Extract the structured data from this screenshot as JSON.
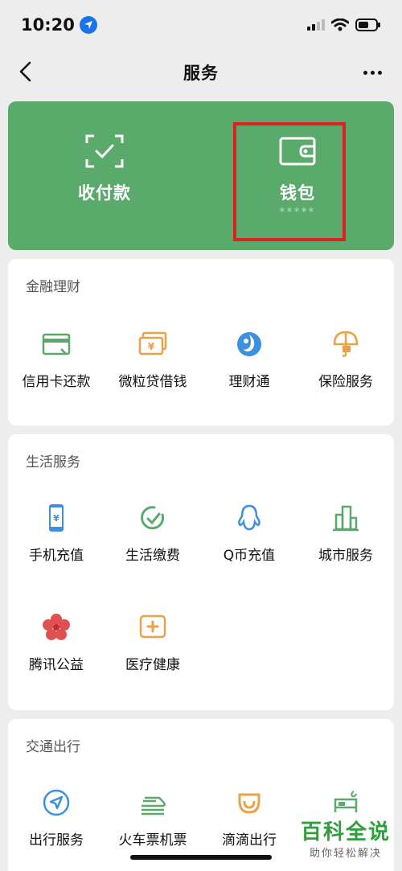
{
  "status_bar": {
    "time": "10:20"
  },
  "nav": {
    "title": "服务"
  },
  "hero": {
    "pay_label": "收付款",
    "wallet_label": "钱包",
    "wallet_balance_masked": "*****",
    "bg_color": "#5aab6b",
    "highlight_color": "#e02020"
  },
  "sections": [
    {
      "title": "金融理财",
      "items": [
        {
          "label": "信用卡还款",
          "icon": "credit-card-icon"
        },
        {
          "label": "微粒贷借钱",
          "icon": "yuan-bills-icon"
        },
        {
          "label": "理财通",
          "icon": "wealth-icon"
        },
        {
          "label": "保险服务",
          "icon": "insurance-umbrella-icon"
        }
      ]
    },
    {
      "title": "生活服务",
      "items": [
        {
          "label": "手机充值",
          "icon": "phone-recharge-icon"
        },
        {
          "label": "生活缴费",
          "icon": "utility-bill-icon"
        },
        {
          "label": "Q币充值",
          "icon": "qq-penguin-icon"
        },
        {
          "label": "城市服务",
          "icon": "city-buildings-icon"
        },
        {
          "label": "腾讯公益",
          "icon": "charity-flower-icon"
        },
        {
          "label": "医疗健康",
          "icon": "medical-cross-icon"
        }
      ]
    },
    {
      "title": "交通出行",
      "items": [
        {
          "label": "出行服务",
          "icon": "navigation-arrow-icon"
        },
        {
          "label": "火车票机票",
          "icon": "train-icon"
        },
        {
          "label": "滴滴出行",
          "icon": "didi-icon"
        },
        {
          "label": "",
          "icon": "hotel-bed-icon"
        }
      ]
    }
  ],
  "watermark": {
    "main": "百科全说",
    "sub": "助你轻松解决"
  }
}
